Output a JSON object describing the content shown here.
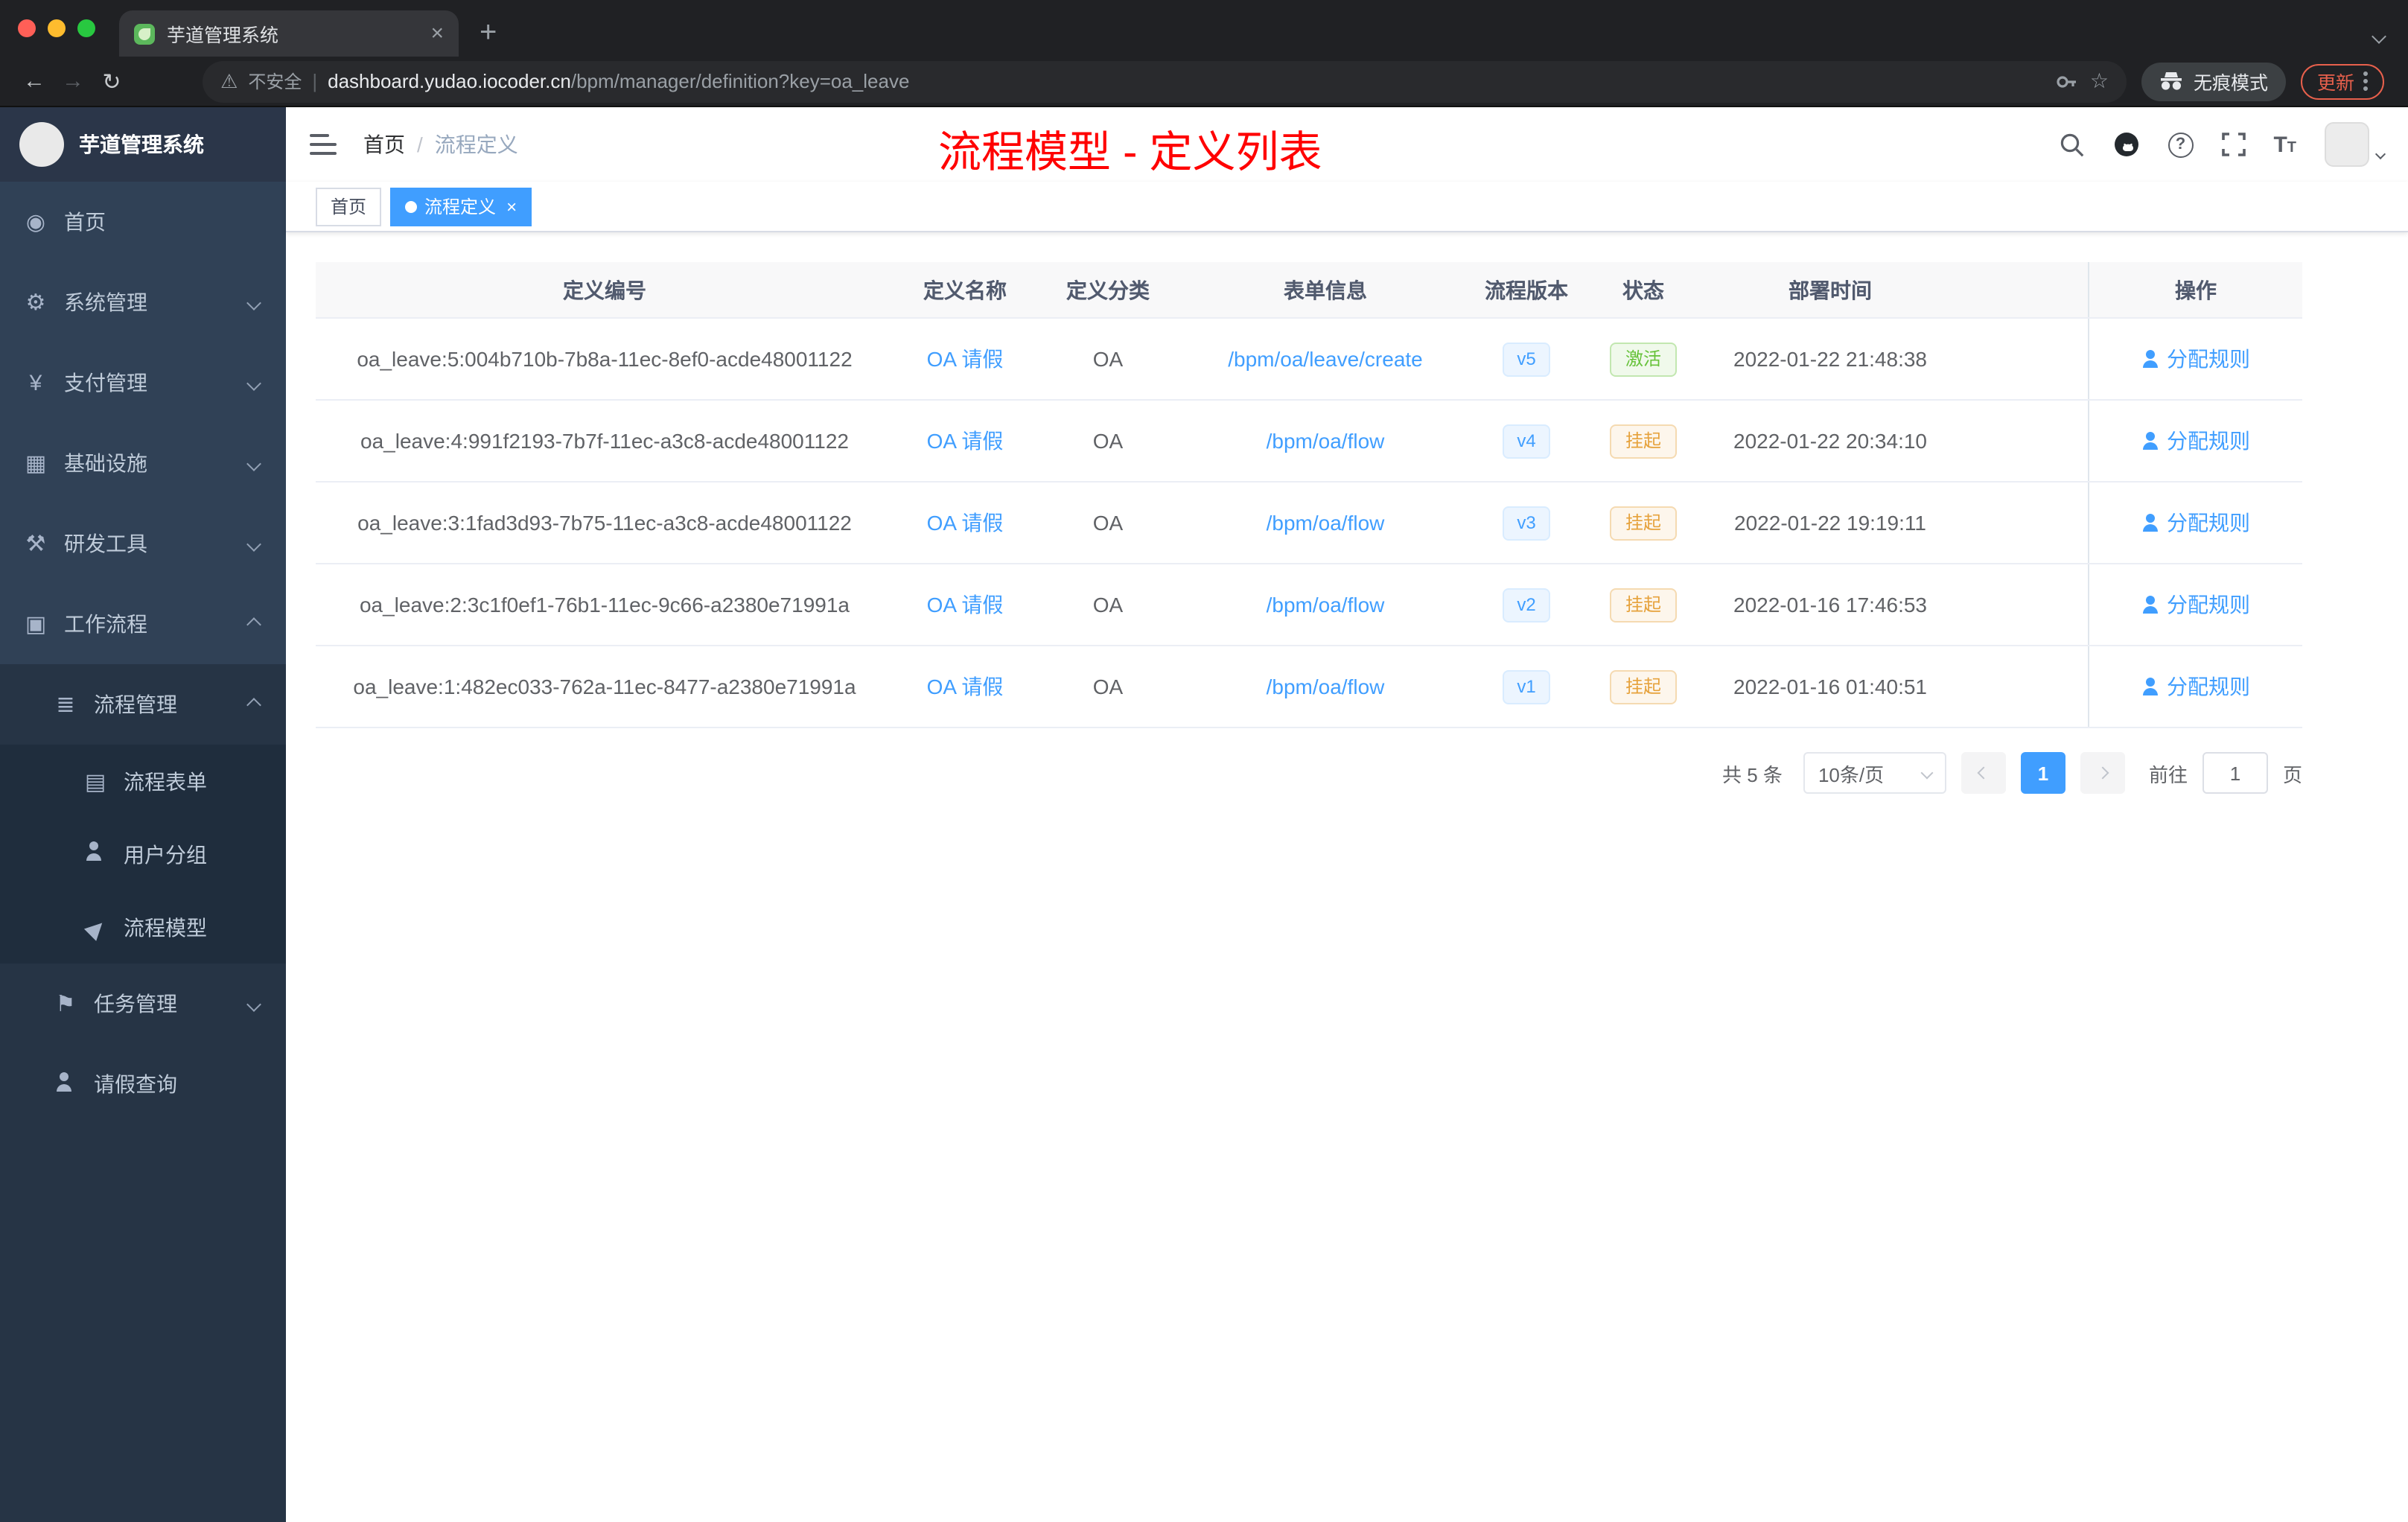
{
  "colors": {
    "accent": "#409eff",
    "sidebar_bg": "#304156",
    "annotation_red": "#ff0000",
    "status_active_green": "#67c23a",
    "status_suspended_yellow": "#e6a23c"
  },
  "browser": {
    "tab_title": "芋道管理系统",
    "tab_close_label": "×",
    "new_tab_label": "+",
    "security_label": "不安全",
    "security_separator": "|",
    "warning_glyph": "⚠",
    "url_domain": "dashboard.yudao.iocoder.cn",
    "url_path": "/bpm/manager/definition?key=oa_leave",
    "star_glyph": "☆",
    "incognito_label": "无痕模式",
    "update_label": "更新"
  },
  "sidebar": {
    "logo_title": "芋道管理系统",
    "menu": [
      {
        "label": "首页",
        "glyph": "◉"
      },
      {
        "label": "系统管理",
        "glyph": "⚙"
      },
      {
        "label": "支付管理",
        "glyph": "¥"
      },
      {
        "label": "基础设施",
        "glyph": "▦"
      },
      {
        "label": "研发工具",
        "glyph": "⚒"
      },
      {
        "label": "工作流程",
        "glyph": "▣"
      }
    ],
    "process_management": {
      "label": "流程管理",
      "glyph": "≣"
    },
    "process_children": [
      {
        "label": "流程表单",
        "glyph": "▤"
      },
      {
        "label": "用户分组",
        "glyph": ""
      },
      {
        "label": "流程模型",
        "glyph": "▶"
      }
    ],
    "task_management": {
      "label": "任务管理",
      "glyph": "⚑"
    },
    "leave_query": {
      "label": "请假查询",
      "glyph": ""
    }
  },
  "navbar": {
    "breadcrumb_home": "首页",
    "breadcrumb_separator": "/",
    "breadcrumb_current": "流程定义",
    "annotation": "流程模型 - 定义列表",
    "help_glyph": "?",
    "size_glyph": "T"
  },
  "tags_view": {
    "home_tag": "首页",
    "active_tag": "流程定义",
    "close_label": "×"
  },
  "table": {
    "columns": [
      "定义编号",
      "定义名称",
      "定义分类",
      "表单信息",
      "流程版本",
      "状态",
      "部署时间",
      "操作"
    ],
    "rows": [
      {
        "id": "oa_leave:5:004b710b-7b8a-11ec-8ef0-acde48001122",
        "name": "OA 请假",
        "category": "OA",
        "form": "/bpm/oa/leave/create",
        "version": "v5",
        "status": "激活",
        "status_type": "success",
        "deploy_time": "2022-01-22 21:48:38",
        "action": "分配规则"
      },
      {
        "id": "oa_leave:4:991f2193-7b7f-11ec-a3c8-acde48001122",
        "name": "OA 请假",
        "category": "OA",
        "form": "/bpm/oa/flow",
        "version": "v4",
        "status": "挂起",
        "status_type": "warning",
        "deploy_time": "2022-01-22 20:34:10",
        "action": "分配规则"
      },
      {
        "id": "oa_leave:3:1fad3d93-7b75-11ec-a3c8-acde48001122",
        "name": "OA 请假",
        "category": "OA",
        "form": "/bpm/oa/flow",
        "version": "v3",
        "status": "挂起",
        "status_type": "warning",
        "deploy_time": "2022-01-22 19:19:11",
        "action": "分配规则"
      },
      {
        "id": "oa_leave:2:3c1f0ef1-76b1-11ec-9c66-a2380e71991a",
        "name": "OA 请假",
        "category": "OA",
        "form": "/bpm/oa/flow",
        "version": "v2",
        "status": "挂起",
        "status_type": "warning",
        "deploy_time": "2022-01-16 17:46:53",
        "action": "分配规则"
      },
      {
        "id": "oa_leave:1:482ec033-762a-11ec-8477-a2380e71991a",
        "name": "OA 请假",
        "category": "OA",
        "form": "/bpm/oa/flow",
        "version": "v1",
        "status": "挂起",
        "status_type": "warning",
        "deploy_time": "2022-01-16 01:40:51",
        "action": "分配规则"
      }
    ]
  },
  "pagination": {
    "total": "共 5 条",
    "page_size": "10条/页",
    "current_page": "1",
    "goto_label": "前往",
    "goto_value": "1",
    "page_unit": "页"
  }
}
